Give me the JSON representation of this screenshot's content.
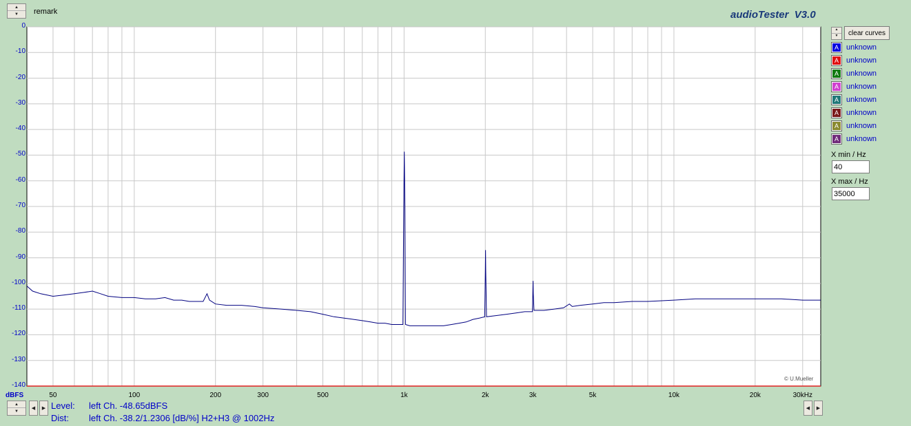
{
  "header": {
    "remark_label": "remark",
    "app_title": "audioTester  V3.0"
  },
  "chart_data": {
    "type": "line",
    "ylabel": "dBFS",
    "ylim": [
      -140,
      0
    ],
    "xlim": [
      40,
      35000
    ],
    "xscale": "log",
    "yticks": [
      0,
      -10,
      -20,
      -30,
      -40,
      -50,
      -60,
      -70,
      -80,
      -90,
      -100,
      -110,
      -120,
      -130,
      -140
    ],
    "xticks": [
      {
        "value": 50,
        "label": "50"
      },
      {
        "value": 100,
        "label": "100"
      },
      {
        "value": 200,
        "label": "200"
      },
      {
        "value": 300,
        "label": "300"
      },
      {
        "value": 500,
        "label": "500"
      },
      {
        "value": 1000,
        "label": "1k"
      },
      {
        "value": 2000,
        "label": "2k"
      },
      {
        "value": 3000,
        "label": "3k"
      },
      {
        "value": 5000,
        "label": "5k"
      },
      {
        "value": 10000,
        "label": "10k"
      },
      {
        "value": 20000,
        "label": "20k"
      },
      {
        "value": 30000,
        "label": "30kHz"
      }
    ],
    "grid": true,
    "series": [
      {
        "color": "#000080",
        "points": [
          [
            40,
            -101
          ],
          [
            42,
            -103
          ],
          [
            45,
            -104
          ],
          [
            50,
            -105
          ],
          [
            55,
            -104.5
          ],
          [
            60,
            -104
          ],
          [
            65,
            -103.5
          ],
          [
            70,
            -103
          ],
          [
            75,
            -104
          ],
          [
            80,
            -105
          ],
          [
            90,
            -105.5
          ],
          [
            100,
            -105.5
          ],
          [
            110,
            -106
          ],
          [
            120,
            -106
          ],
          [
            130,
            -105.5
          ],
          [
            140,
            -106.5
          ],
          [
            150,
            -106.5
          ],
          [
            160,
            -107
          ],
          [
            170,
            -107
          ],
          [
            180,
            -107
          ],
          [
            186,
            -104
          ],
          [
            190,
            -106.5
          ],
          [
            200,
            -108
          ],
          [
            220,
            -108.5
          ],
          [
            250,
            -108.5
          ],
          [
            280,
            -109
          ],
          [
            300,
            -109.5
          ],
          [
            350,
            -110
          ],
          [
            400,
            -110.5
          ],
          [
            450,
            -111
          ],
          [
            500,
            -112
          ],
          [
            550,
            -113
          ],
          [
            600,
            -113.5
          ],
          [
            650,
            -114
          ],
          [
            700,
            -114.5
          ],
          [
            750,
            -115
          ],
          [
            800,
            -115.5
          ],
          [
            850,
            -115.5
          ],
          [
            900,
            -116
          ],
          [
            950,
            -116
          ],
          [
            990,
            -116
          ],
          [
            997,
            -70
          ],
          [
            1002,
            -48.65
          ],
          [
            1007,
            -70
          ],
          [
            1012,
            -116
          ],
          [
            1050,
            -116.5
          ],
          [
            1100,
            -116.5
          ],
          [
            1200,
            -116.5
          ],
          [
            1300,
            -116.5
          ],
          [
            1400,
            -116.5
          ],
          [
            1500,
            -116
          ],
          [
            1600,
            -115.5
          ],
          [
            1700,
            -115
          ],
          [
            1800,
            -114
          ],
          [
            1900,
            -113.5
          ],
          [
            1990,
            -113
          ],
          [
            2000,
            -95
          ],
          [
            2004,
            -87
          ],
          [
            2008,
            -95
          ],
          [
            2020,
            -113
          ],
          [
            2200,
            -112.5
          ],
          [
            2400,
            -112
          ],
          [
            2600,
            -111.5
          ],
          [
            2800,
            -111
          ],
          [
            2990,
            -111
          ],
          [
            3000,
            -104
          ],
          [
            3006,
            -99
          ],
          [
            3012,
            -104
          ],
          [
            3030,
            -110.5
          ],
          [
            3300,
            -110.5
          ],
          [
            3600,
            -110
          ],
          [
            3900,
            -109.5
          ],
          [
            4100,
            -108
          ],
          [
            4200,
            -109
          ],
          [
            4500,
            -108.5
          ],
          [
            5000,
            -108
          ],
          [
            5500,
            -107.5
          ],
          [
            6000,
            -107.5
          ],
          [
            7000,
            -107
          ],
          [
            8000,
            -107
          ],
          [
            10000,
            -106.5
          ],
          [
            12000,
            -106
          ],
          [
            15000,
            -106
          ],
          [
            20000,
            -106
          ],
          [
            25000,
            -106
          ],
          [
            30000,
            -106.5
          ],
          [
            35000,
            -106.5
          ]
        ]
      }
    ]
  },
  "copyright": "© U.Mueller",
  "status": {
    "level_label": "Level:",
    "level_value": "left Ch. -48.65dBFS",
    "dist_label": "Dist:",
    "dist_value": "left Ch. -38.2/1.2306 [dB/%] H2+H3 @ 1002Hz"
  },
  "sidebar": {
    "clear_curves_label": "clear curves",
    "curves": [
      {
        "label": "unknown",
        "color": "#0000e0",
        "letter": "A"
      },
      {
        "label": "unknown",
        "color": "#e01010",
        "letter": "A"
      },
      {
        "label": "unknown",
        "color": "#107a10",
        "letter": "A"
      },
      {
        "label": "unknown",
        "color": "#d040d0",
        "letter": "A"
      },
      {
        "label": "unknown",
        "color": "#207878",
        "letter": "A"
      },
      {
        "label": "unknown",
        "color": "#7a1a1a",
        "letter": "A"
      },
      {
        "label": "unknown",
        "color": "#8a8a30",
        "letter": "A"
      },
      {
        "label": "unknown",
        "color": "#702a7a",
        "letter": "A"
      }
    ],
    "xmin_label": "X min / Hz",
    "xmin_value": "40",
    "xmax_label": "X max / Hz",
    "xmax_value": "35000"
  }
}
